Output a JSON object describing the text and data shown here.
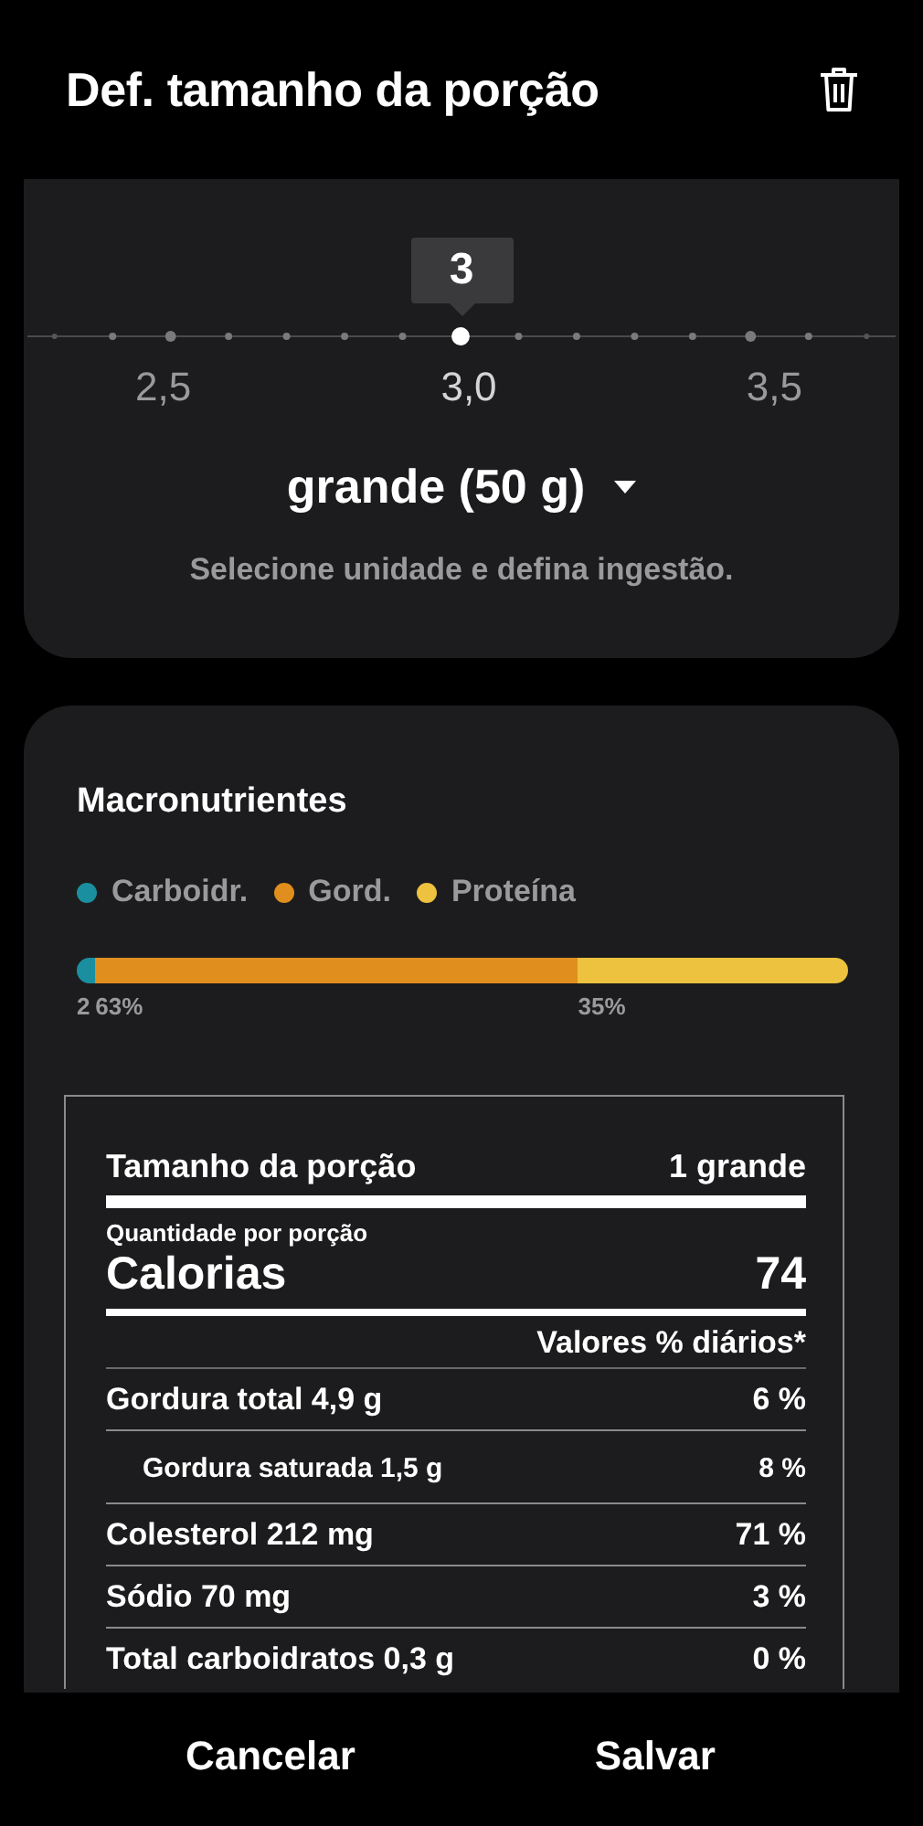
{
  "header": {
    "title": "Def. tamanho da porção"
  },
  "serving": {
    "bubble": "3",
    "scale": [
      {
        "label": "2,5",
        "selected": false
      },
      {
        "label": "3,0",
        "selected": true
      },
      {
        "label": "3,5",
        "selected": false
      }
    ],
    "unit": "grande (50 g)",
    "hint": "Selecione unidade e defina ingestão."
  },
  "macros": {
    "title": "Macronutrientes",
    "items": [
      {
        "name": "Carboidr.",
        "color": "#1a8fa0",
        "share": "2"
      },
      {
        "name": "Gord.",
        "color": "#e08e1e",
        "share": "63%"
      },
      {
        "name": "Proteína",
        "color": "#ecc23f",
        "share": "35%"
      }
    ]
  },
  "facts": {
    "rows": [
      {
        "kind": "serving",
        "label": "Tamanho da porção",
        "value": "1 grande"
      },
      {
        "kind": "caption",
        "label": "Quantidade por porção"
      },
      {
        "kind": "calories",
        "label": "Calorias",
        "value": "74"
      },
      {
        "kind": "dv",
        "value": "Valores % diários*"
      },
      {
        "kind": "nutrient",
        "label": "Gordura total 4,9 g",
        "value": "6 %"
      },
      {
        "kind": "sub",
        "label": "Gordura saturada 1,5 g",
        "value": "8 %"
      },
      {
        "kind": "nutrient",
        "label": "Colesterol 212 mg",
        "value": "71 %"
      },
      {
        "kind": "nutrient",
        "label": "Sódio 70 mg",
        "value": "3 %"
      },
      {
        "kind": "nutrient",
        "label": "Total carboidratos 0,3 g",
        "value": "0 %"
      }
    ]
  },
  "buttons": [
    "Cancelar",
    "Salvar"
  ]
}
